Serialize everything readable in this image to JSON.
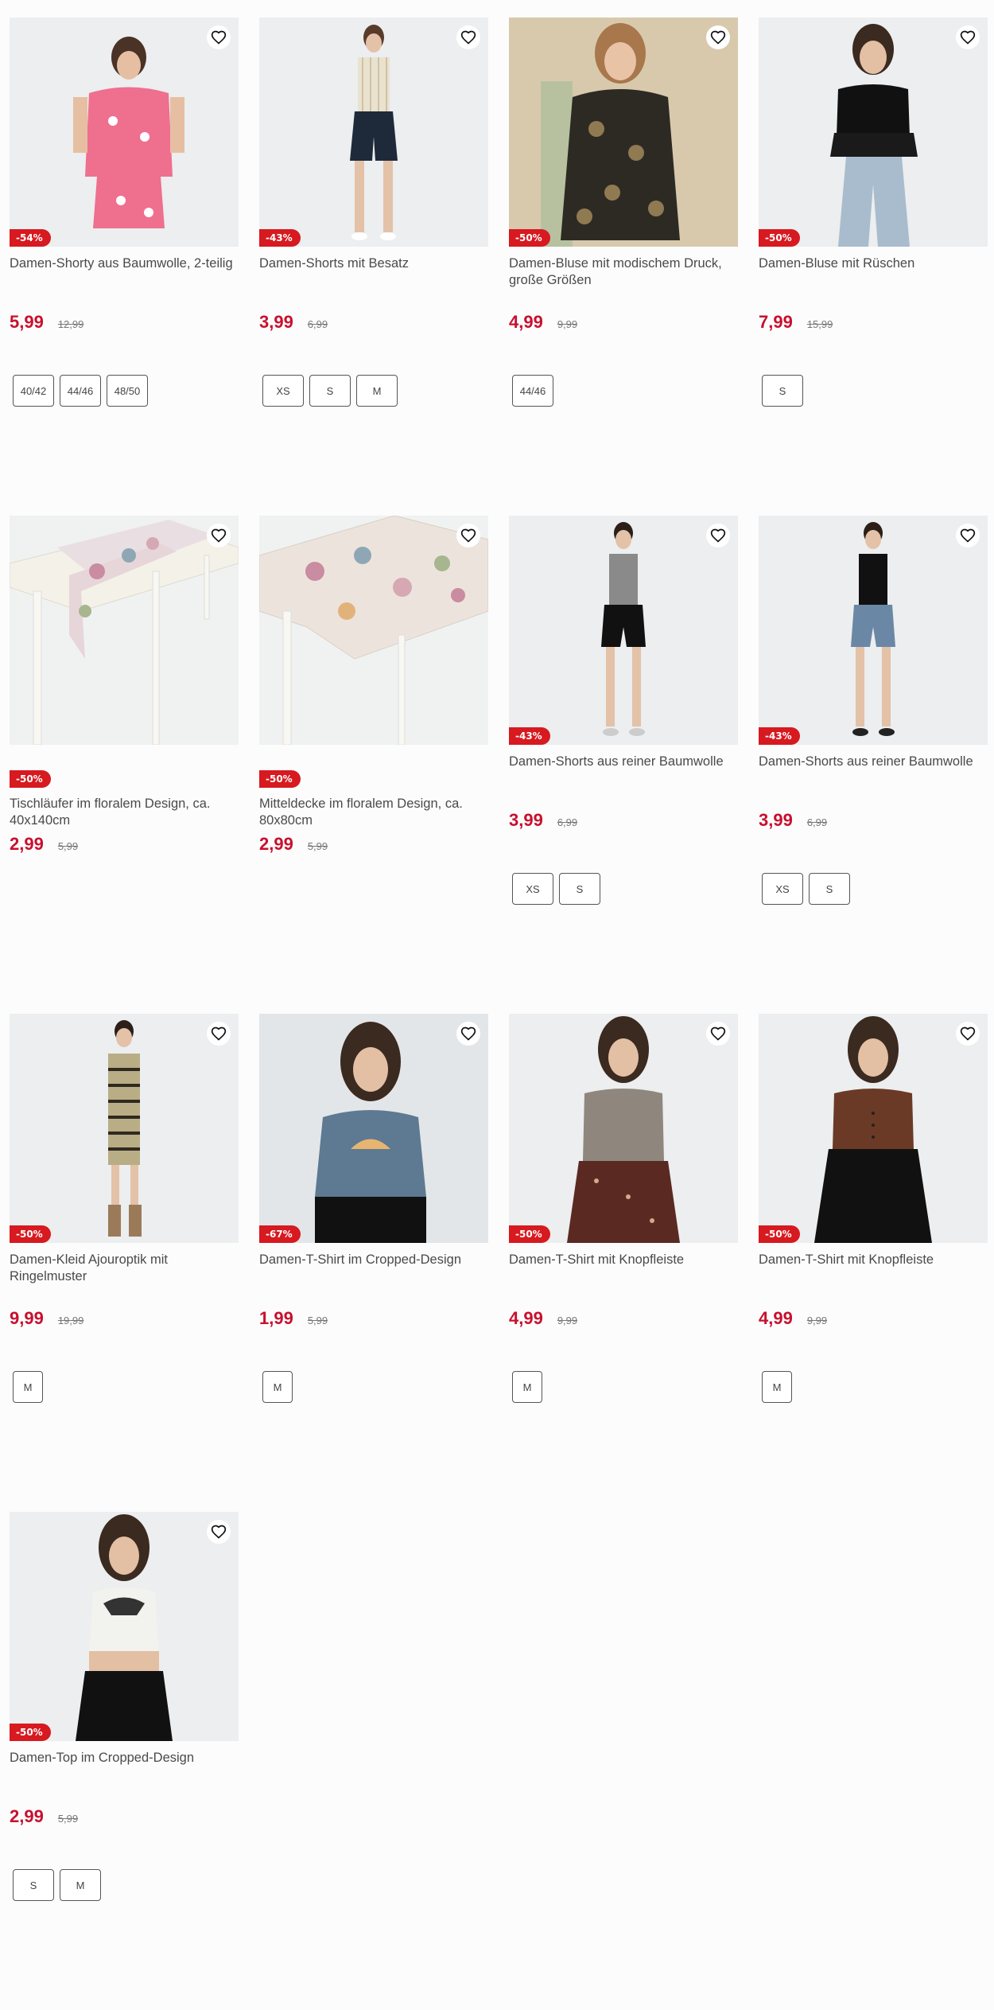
{
  "products": [
    {
      "title": "Damen-Shorty aus Baumwolle, 2-teilig",
      "price": "5,99",
      "old_price": "12,99",
      "discount": "-54%",
      "sizes": [
        "40/42",
        "44/46",
        "48/50"
      ]
    },
    {
      "title": "Damen-Shorts mit Besatz",
      "price": "3,99",
      "old_price": "6,99",
      "discount": "-43%",
      "sizes": [
        "XS",
        "S",
        "M"
      ]
    },
    {
      "title": "Damen-Bluse mit modischem Druck, große Größen",
      "price": "4,99",
      "old_price": "9,99",
      "discount": "-50%",
      "sizes": [
        "44/46"
      ]
    },
    {
      "title": "Damen-Bluse mit Rüschen",
      "price": "7,99",
      "old_price": "15,99",
      "discount": "-50%",
      "sizes": [
        "S"
      ]
    },
    {
      "title": "Tischläufer im floralem Design, ca. 40x140cm",
      "price": "2,99",
      "old_price": "5,99",
      "discount": "-50%",
      "sizes": []
    },
    {
      "title": "Mitteldecke im floralem Design, ca. 80x80cm",
      "price": "2,99",
      "old_price": "5,99",
      "discount": "-50%",
      "sizes": []
    },
    {
      "title": "Damen-Shorts aus reiner Baumwolle",
      "price": "3,99",
      "old_price": "6,99",
      "discount": "-43%",
      "sizes": [
        "XS",
        "S"
      ]
    },
    {
      "title": "Damen-Shorts aus reiner Baumwolle",
      "price": "3,99",
      "old_price": "6,99",
      "discount": "-43%",
      "sizes": [
        "XS",
        "S"
      ]
    },
    {
      "title": "Damen-Kleid Ajouroptik mit Ringelmuster",
      "price": "9,99",
      "old_price": "19,99",
      "discount": "-50%",
      "sizes": [
        "M"
      ]
    },
    {
      "title": "Damen-T-Shirt im Cropped-Design",
      "price": "1,99",
      "old_price": "5,99",
      "discount": "-67%",
      "sizes": [
        "M"
      ]
    },
    {
      "title": "Damen-T-Shirt mit Knopfleiste",
      "price": "4,99",
      "old_price": "9,99",
      "discount": "-50%",
      "sizes": [
        "M"
      ]
    },
    {
      "title": "Damen-T-Shirt mit Knopfleiste",
      "price": "4,99",
      "old_price": "9,99",
      "discount": "-50%",
      "sizes": [
        "M"
      ]
    },
    {
      "title": "Damen-Top im Cropped-Design",
      "price": "2,99",
      "old_price": "5,99",
      "discount": "-50%",
      "sizes": [
        "S",
        "M"
      ]
    }
  ],
  "colors": {
    "accent": "#c8102e",
    "badge": "#d71920"
  },
  "icons": {
    "favorite": "heart-icon"
  }
}
